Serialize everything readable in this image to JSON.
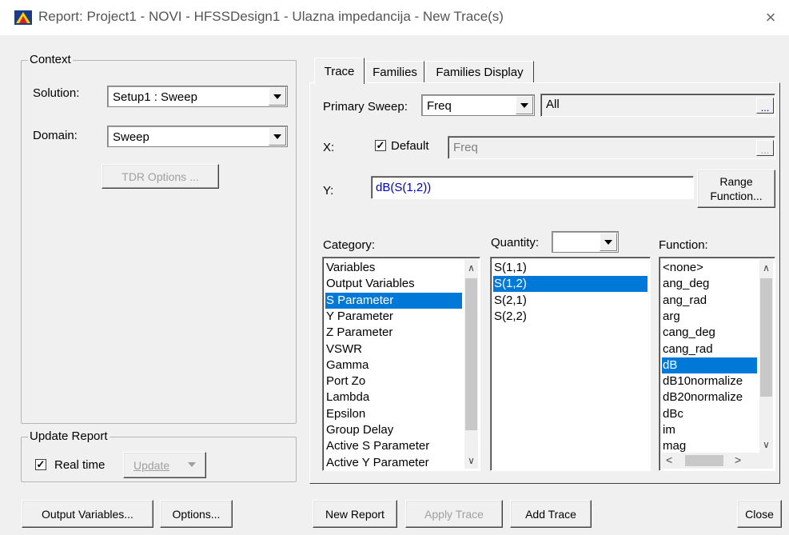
{
  "window": {
    "title": "Report: Project1 - NOVI - HFSSDesign1 - Ulazna impedancija - New Trace(s)",
    "close_glyph": "×",
    "icon": "ansys-report-icon"
  },
  "context": {
    "group_title": "Context",
    "solution_label": "Solution:",
    "solution_value": "Setup1 : Sweep",
    "domain_label": "Domain:",
    "domain_value": "Sweep",
    "tdr_button": "TDR Options ..."
  },
  "update_report": {
    "group_title": "Update Report",
    "realtime_label": "Real time",
    "realtime_checked": true,
    "update_button": "Update"
  },
  "tabs": [
    {
      "label": "Trace",
      "active": true
    },
    {
      "label": "Families",
      "active": false
    },
    {
      "label": "Families Display",
      "active": false
    }
  ],
  "trace": {
    "primary_sweep_label": "Primary Sweep:",
    "primary_sweep_value": "Freq",
    "sweep_range_value": "All",
    "ellipsis": "...",
    "x_label": "X:",
    "x_default_label": "Default",
    "x_default_checked": true,
    "x_value": "Freq",
    "y_label": "Y:",
    "y_value": "dB(S(1,2))",
    "range_function_line1": "Range",
    "range_function_line2": "Function...",
    "category_label": "Category:",
    "quantity_label": "Quantity:",
    "quantity_filter_value": "",
    "function_label": "Function:",
    "categories": [
      "Variables",
      "Output Variables",
      "S Parameter",
      "Y Parameter",
      "Z Parameter",
      "VSWR",
      "Gamma",
      "Port Zo",
      "Lambda",
      "Epsilon",
      "Group Delay",
      "Active S Parameter",
      "Active Y Parameter"
    ],
    "category_selected": "S Parameter",
    "quantities": [
      "S(1,1)",
      "S(1,2)",
      "S(2,1)",
      "S(2,2)"
    ],
    "quantity_selected": "S(1,2)",
    "functions": [
      "<none>",
      "ang_deg",
      "ang_rad",
      "arg",
      "cang_deg",
      "cang_rad",
      "dB",
      "dB10normalize",
      "dB20normalize",
      "dBc",
      "im",
      "mag"
    ],
    "function_selected": "dB"
  },
  "bottom_buttons": {
    "output_variables": "Output Variables...",
    "options": "Options...",
    "new_report": "New Report",
    "apply_trace": "Apply Trace",
    "add_trace": "Add Trace",
    "close": "Close"
  }
}
